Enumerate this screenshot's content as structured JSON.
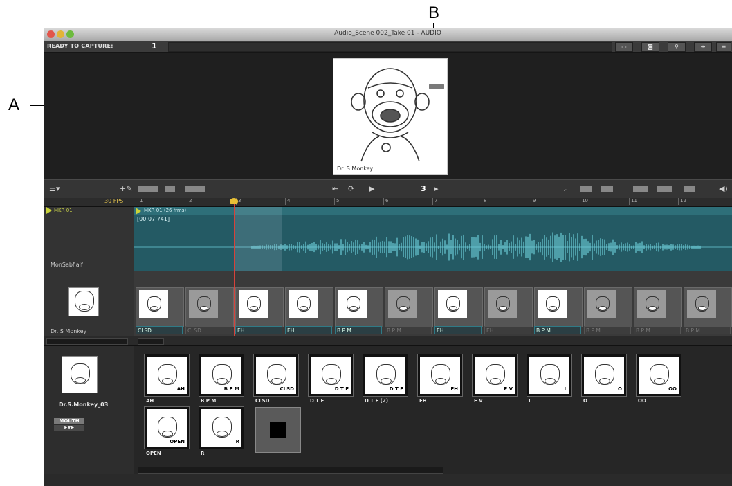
{
  "callouts": {
    "a": "A",
    "b": "B"
  },
  "window": {
    "title": "Audio_Scene 002_Take 01 - AUDIO"
  },
  "capture_bar": {
    "status": "READY TO CAPTURE:",
    "count": "1"
  },
  "viewer": {
    "frame_caption": "Dr. S Monkey"
  },
  "toolbar": {
    "frame_number": "3"
  },
  "ruler": {
    "fps": "30 FPS",
    "ticks": [
      "1",
      "2",
      "3",
      "4",
      "5",
      "6",
      "7",
      "8",
      "9",
      "10",
      "11",
      "12"
    ]
  },
  "tracks": {
    "marker_label": "MKR 01",
    "marker_detail": "MKR 01 (26 frms)",
    "audio_timestamp": "[00:07.741]",
    "audio_file": "MonSabf.aif",
    "mouth_track_name": "Dr. S Monkey",
    "mouth_frames": [
      {
        "label": "CLSD",
        "dim": false
      },
      {
        "label": "CLSD",
        "dim": true
      },
      {
        "label": "EH",
        "dim": false
      },
      {
        "label": "EH",
        "dim": false
      },
      {
        "label": "B P M",
        "dim": false
      },
      {
        "label": "B P M",
        "dim": true
      },
      {
        "label": "EH",
        "dim": false
      },
      {
        "label": "EH",
        "dim": true
      },
      {
        "label": "B P M",
        "dim": false
      },
      {
        "label": "B P M",
        "dim": true
      },
      {
        "label": "B P M",
        "dim": true
      },
      {
        "label": "B P M",
        "dim": true
      }
    ]
  },
  "library": {
    "character_name": "Dr.S.Monkey_03",
    "categories": [
      "MOUTH",
      "EYE"
    ],
    "mouth_shapes": [
      {
        "tag": "AH",
        "name": "AH"
      },
      {
        "tag": "B P M",
        "name": "B P M"
      },
      {
        "tag": "CLSD",
        "name": "CLSD"
      },
      {
        "tag": "D T E",
        "name": "D T E"
      },
      {
        "tag": "D T E",
        "name": "D T E (2)"
      },
      {
        "tag": "EH",
        "name": "EH"
      },
      {
        "tag": "F V",
        "name": "F V"
      },
      {
        "tag": "L",
        "name": "L"
      },
      {
        "tag": "O",
        "name": "O"
      },
      {
        "tag": "OO",
        "name": "OO"
      },
      {
        "tag": "OPEN",
        "name": "OPEN"
      },
      {
        "tag": "R",
        "name": "R"
      }
    ]
  }
}
